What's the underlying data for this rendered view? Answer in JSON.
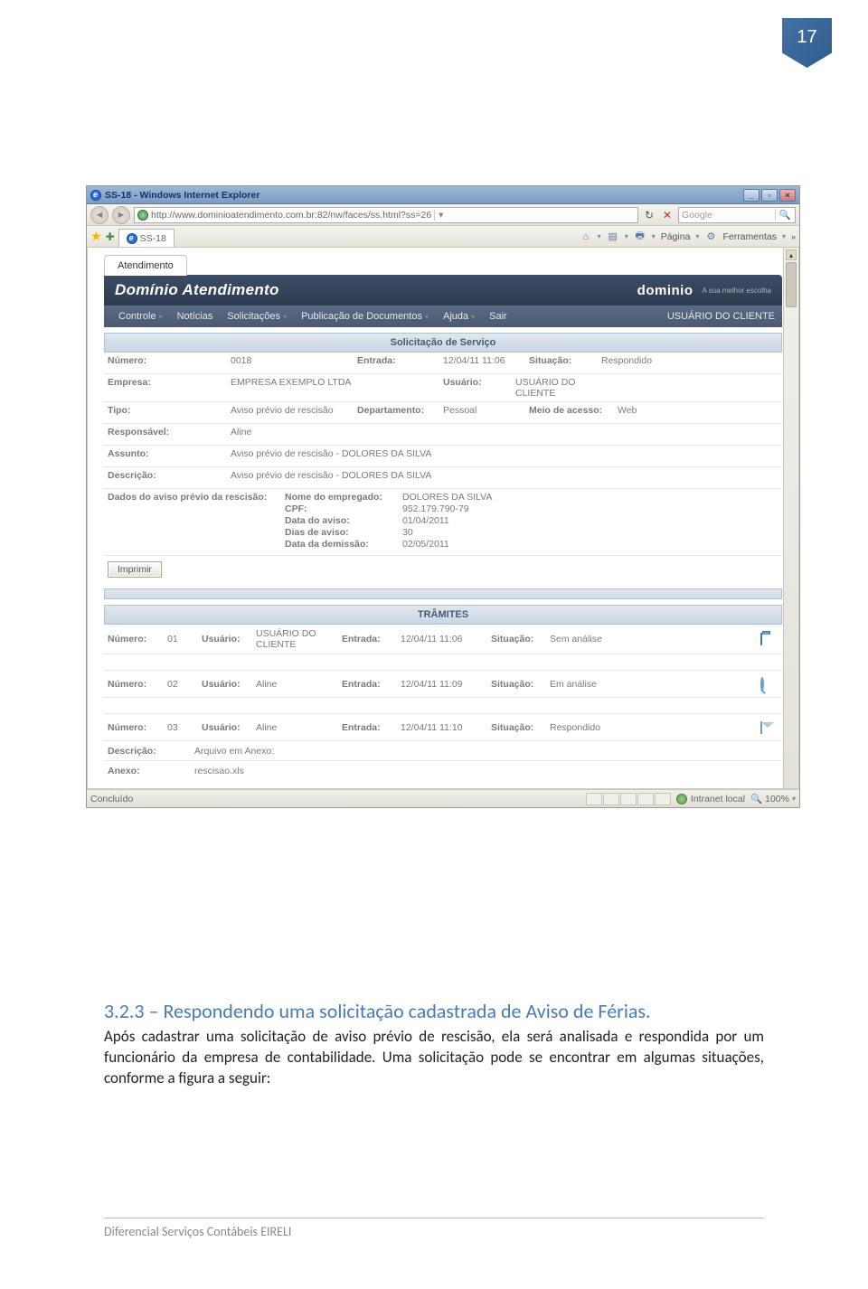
{
  "page_number": "17",
  "browser": {
    "title": "SS-18 - Windows Internet Explorer",
    "url": "http://www.dominioatendimento.com.br:82/nw/faces/ss.html?ss=26",
    "search_placeholder": "Google",
    "tab_label": "SS-18",
    "menu_page": "Página",
    "menu_tools": "Ferramentas",
    "status_left": "Concluído",
    "status_zone": "Intranet local",
    "zoom": "100%"
  },
  "app": {
    "tab": "Atendimento",
    "banner_title": "Domínio Atendimento",
    "logo": "dominio",
    "tagline": "A sua melhor escolha",
    "menu": [
      "Controle",
      "Notícias",
      "Solicitações",
      "Publicação de Documentos",
      "Ajuda",
      "Sair"
    ],
    "menu_right": "USUÁRIO DO CLIENTE"
  },
  "section_title": "Solicitação de Serviço",
  "solic": {
    "numero_label": "Número:",
    "numero": "0018",
    "entrada_label": "Entrada:",
    "entrada": "12/04/11 11:06",
    "situacao_label": "Situação:",
    "situacao": "Respondido",
    "empresa_label": "Empresa:",
    "empresa": "EMPRESA EXEMPLO LTDA",
    "usuario_label": "Usuário:",
    "usuario": "USUÁRIO DO CLIENTE",
    "tipo_label": "Tipo:",
    "tipo": "Aviso prévio de rescisão",
    "dept_label": "Departamento:",
    "dept": "Pessoal",
    "meio_label": "Meio de acesso:",
    "meio": "Web",
    "responsavel_label": "Responsável:",
    "responsavel": "Aline",
    "assunto_label": "Assunto:",
    "assunto": "Aviso prévio de rescisão - DOLORES DA SILVA",
    "descricao_label": "Descrição:",
    "descricao": "Aviso prévio de rescisão - DOLORES DA SILVA",
    "dados_label": "Dados do aviso prévio da rescisão:",
    "dados": {
      "nome_label": "Nome do empregado:",
      "nome": "DOLORES DA SILVA",
      "cpf_label": "CPF:",
      "cpf": "952.179.790-79",
      "data_aviso_label": "Data do aviso:",
      "data_aviso": "01/04/2011",
      "dias_label": "Dias de aviso:",
      "dias": "30",
      "data_dem_label": "Data da demissão:",
      "data_dem": "02/05/2011"
    },
    "print_btn": "Imprimir"
  },
  "tramites_title": "TRÂMITES",
  "tramites": [
    {
      "numero_label": "Número:",
      "numero": "01",
      "usuario_label": "Usuário:",
      "usuario": "USUÁRIO DO CLIENTE",
      "entrada_label": "Entrada:",
      "entrada": "12/04/11 11:06",
      "situacao_label": "Situação:",
      "situacao": "Sem análise",
      "icon": "folder"
    },
    {
      "numero_label": "Número:",
      "numero": "02",
      "usuario_label": "Usuário:",
      "usuario": "Aline",
      "entrada_label": "Entrada:",
      "entrada": "12/04/11 11:09",
      "situacao_label": "Situação:",
      "situacao": "Em análise",
      "icon": "magnify"
    },
    {
      "numero_label": "Número:",
      "numero": "03",
      "usuario_label": "Usuário:",
      "usuario": "Aline",
      "entrada_label": "Entrada:",
      "entrada": "12/04/11 11:10",
      "situacao_label": "Situação:",
      "situacao": "Respondido",
      "icon": "envelope"
    }
  ],
  "detail": {
    "descricao_label": "Descrição:",
    "descricao": "Arquivo em Anexo:",
    "anexo_label": "Anexo:",
    "anexo": "rescisao.xls"
  },
  "body": {
    "heading": "3.2.3 – Respondendo uma solicitação cadastrada de Aviso de Férias.",
    "paragraph": "Após cadastrar uma solicitação de aviso prévio de rescisão, ela será analisada e respondida por um funcionário da empresa de contabilidade. Uma solicitação pode se encontrar em algumas situações, conforme a figura a seguir:"
  },
  "footer": "Diferencial Serviços Contábeis EIRELI"
}
